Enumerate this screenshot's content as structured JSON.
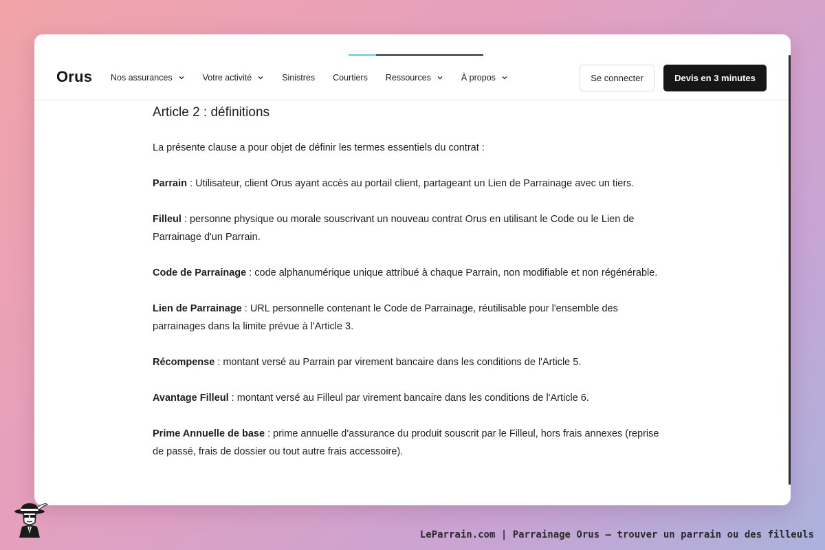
{
  "nav": {
    "logo": "Orus",
    "menu": [
      {
        "label": "Nos assurances",
        "has_dropdown": true
      },
      {
        "label": "Votre activité",
        "has_dropdown": true
      },
      {
        "label": "Sinistres",
        "has_dropdown": false
      },
      {
        "label": "Courtiers",
        "has_dropdown": false
      },
      {
        "label": "Ressources",
        "has_dropdown": true
      },
      {
        "label": "À propos",
        "has_dropdown": true
      }
    ],
    "login_label": "Se connecter",
    "quote_label": "Devis en 3 minutes"
  },
  "article": {
    "title": "Article 2 : définitions",
    "intro": "La présente clause a pour objet de définir les termes essentiels du contrat :",
    "definitions": [
      {
        "term": "Parrain",
        "text": " : Utilisateur, client Orus ayant accès au portail client, partageant un Lien de Parrainage avec un tiers."
      },
      {
        "term": "Filleul",
        "text": " : personne physique ou morale souscrivant un nouveau contrat Orus en utilisant le Code ou le Lien de Parrainage d'un Parrain."
      },
      {
        "term": "Code de Parrainage",
        "text": " : code alphanumérique unique attribué à chaque Parrain, non modifiable et non régénérable."
      },
      {
        "term": "Lien de Parrainage",
        "text": " : URL personnelle contenant le Code de Parrainage, réutilisable pour l'ensemble des parrainages dans la limite prévue à l'Article 3."
      },
      {
        "term": "Récompense",
        "text": " : montant versé au Parrain par virement bancaire dans les conditions de l'Article 5."
      },
      {
        "term": "Avantage Filleul",
        "text": " : montant versé au Filleul par virement bancaire dans les conditions de l'Article 6."
      },
      {
        "term": "Prime Annuelle de base",
        "text": " : prime annuelle d'assurance du produit souscrit par le Filleul, hors frais annexes (reprise de passé, frais de dossier ou tout autre frais accessoire)."
      }
    ]
  },
  "footer": {
    "caption": "LeParrain.com | Parrainage Orus — trouver un parrain ou des filleuls"
  },
  "colors": {
    "accent_progress": "#64c8d4",
    "primary_button": "#161616"
  },
  "icons": {
    "dropdown": "chevron-down-icon",
    "footer_logo": "mascot-logo-icon"
  }
}
